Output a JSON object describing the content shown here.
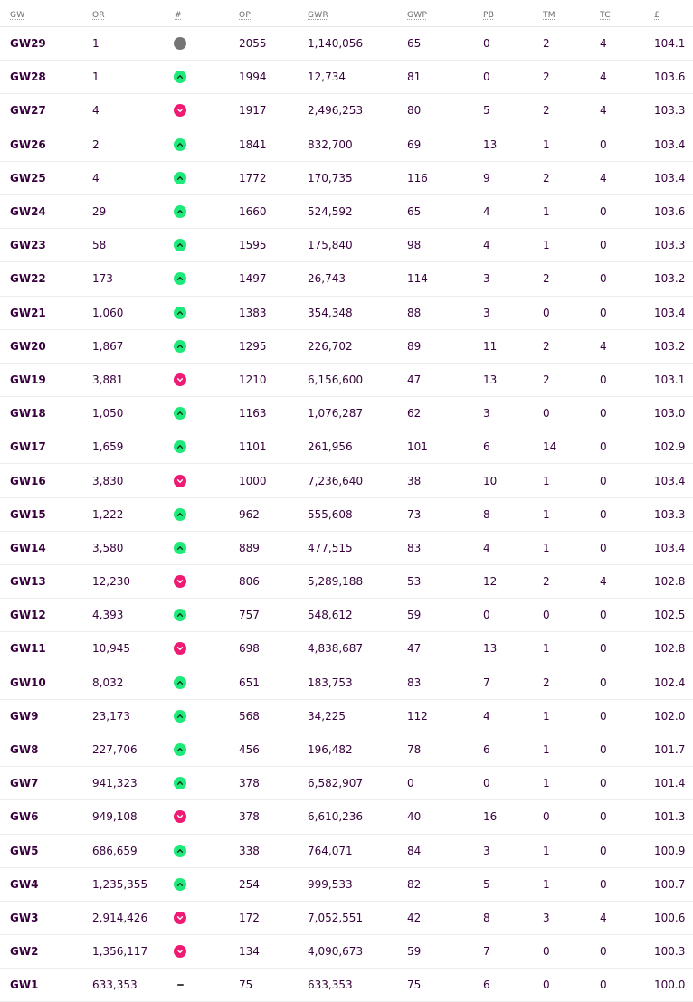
{
  "headers": [
    "GW",
    "OR",
    "#",
    "OP",
    "GWR",
    "GWP",
    "PB",
    "TM",
    "TC",
    "£"
  ],
  "colors": {
    "up": "#1fe97a",
    "down": "#ee1a73",
    "same": "#757575",
    "text": "#37003c"
  },
  "icons": {
    "up": "chevron-up-icon",
    "down": "chevron-down-icon",
    "same": "no-change-icon",
    "none": "dash-icon"
  },
  "rows": [
    {
      "gw": "GW29",
      "or": "1",
      "move": "same",
      "op": "2055",
      "gwr": "1,140,056",
      "gwp": "65",
      "pb": "0",
      "tm": "2",
      "tc": "4",
      "value": "104.1"
    },
    {
      "gw": "GW28",
      "or": "1",
      "move": "up",
      "op": "1994",
      "gwr": "12,734",
      "gwp": "81",
      "pb": "0",
      "tm": "2",
      "tc": "4",
      "value": "103.6"
    },
    {
      "gw": "GW27",
      "or": "4",
      "move": "down",
      "op": "1917",
      "gwr": "2,496,253",
      "gwp": "80",
      "pb": "5",
      "tm": "2",
      "tc": "4",
      "value": "103.3"
    },
    {
      "gw": "GW26",
      "or": "2",
      "move": "up",
      "op": "1841",
      "gwr": "832,700",
      "gwp": "69",
      "pb": "13",
      "tm": "1",
      "tc": "0",
      "value": "103.4"
    },
    {
      "gw": "GW25",
      "or": "4",
      "move": "up",
      "op": "1772",
      "gwr": "170,735",
      "gwp": "116",
      "pb": "9",
      "tm": "2",
      "tc": "4",
      "value": "103.4"
    },
    {
      "gw": "GW24",
      "or": "29",
      "move": "up",
      "op": "1660",
      "gwr": "524,592",
      "gwp": "65",
      "pb": "4",
      "tm": "1",
      "tc": "0",
      "value": "103.6"
    },
    {
      "gw": "GW23",
      "or": "58",
      "move": "up",
      "op": "1595",
      "gwr": "175,840",
      "gwp": "98",
      "pb": "4",
      "tm": "1",
      "tc": "0",
      "value": "103.3"
    },
    {
      "gw": "GW22",
      "or": "173",
      "move": "up",
      "op": "1497",
      "gwr": "26,743",
      "gwp": "114",
      "pb": "3",
      "tm": "2",
      "tc": "0",
      "value": "103.2"
    },
    {
      "gw": "GW21",
      "or": "1,060",
      "move": "up",
      "op": "1383",
      "gwr": "354,348",
      "gwp": "88",
      "pb": "3",
      "tm": "0",
      "tc": "0",
      "value": "103.4"
    },
    {
      "gw": "GW20",
      "or": "1,867",
      "move": "up",
      "op": "1295",
      "gwr": "226,702",
      "gwp": "89",
      "pb": "11",
      "tm": "2",
      "tc": "4",
      "value": "103.2"
    },
    {
      "gw": "GW19",
      "or": "3,881",
      "move": "down",
      "op": "1210",
      "gwr": "6,156,600",
      "gwp": "47",
      "pb": "13",
      "tm": "2",
      "tc": "0",
      "value": "103.1"
    },
    {
      "gw": "GW18",
      "or": "1,050",
      "move": "up",
      "op": "1163",
      "gwr": "1,076,287",
      "gwp": "62",
      "pb": "3",
      "tm": "0",
      "tc": "0",
      "value": "103.0"
    },
    {
      "gw": "GW17",
      "or": "1,659",
      "move": "up",
      "op": "1101",
      "gwr": "261,956",
      "gwp": "101",
      "pb": "6",
      "tm": "14",
      "tc": "0",
      "value": "102.9"
    },
    {
      "gw": "GW16",
      "or": "3,830",
      "move": "down",
      "op": "1000",
      "gwr": "7,236,640",
      "gwp": "38",
      "pb": "10",
      "tm": "1",
      "tc": "0",
      "value": "103.4"
    },
    {
      "gw": "GW15",
      "or": "1,222",
      "move": "up",
      "op": "962",
      "gwr": "555,608",
      "gwp": "73",
      "pb": "8",
      "tm": "1",
      "tc": "0",
      "value": "103.3"
    },
    {
      "gw": "GW14",
      "or": "3,580",
      "move": "up",
      "op": "889",
      "gwr": "477,515",
      "gwp": "83",
      "pb": "4",
      "tm": "1",
      "tc": "0",
      "value": "103.4"
    },
    {
      "gw": "GW13",
      "or": "12,230",
      "move": "down",
      "op": "806",
      "gwr": "5,289,188",
      "gwp": "53",
      "pb": "12",
      "tm": "2",
      "tc": "4",
      "value": "102.8"
    },
    {
      "gw": "GW12",
      "or": "4,393",
      "move": "up",
      "op": "757",
      "gwr": "548,612",
      "gwp": "59",
      "pb": "0",
      "tm": "0",
      "tc": "0",
      "value": "102.5"
    },
    {
      "gw": "GW11",
      "or": "10,945",
      "move": "down",
      "op": "698",
      "gwr": "4,838,687",
      "gwp": "47",
      "pb": "13",
      "tm": "1",
      "tc": "0",
      "value": "102.8"
    },
    {
      "gw": "GW10",
      "or": "8,032",
      "move": "up",
      "op": "651",
      "gwr": "183,753",
      "gwp": "83",
      "pb": "7",
      "tm": "2",
      "tc": "0",
      "value": "102.4"
    },
    {
      "gw": "GW9",
      "or": "23,173",
      "move": "up",
      "op": "568",
      "gwr": "34,225",
      "gwp": "112",
      "pb": "4",
      "tm": "1",
      "tc": "0",
      "value": "102.0"
    },
    {
      "gw": "GW8",
      "or": "227,706",
      "move": "up",
      "op": "456",
      "gwr": "196,482",
      "gwp": "78",
      "pb": "6",
      "tm": "1",
      "tc": "0",
      "value": "101.7"
    },
    {
      "gw": "GW7",
      "or": "941,323",
      "move": "up",
      "op": "378",
      "gwr": "6,582,907",
      "gwp": "0",
      "pb": "0",
      "tm": "1",
      "tc": "0",
      "value": "101.4"
    },
    {
      "gw": "GW6",
      "or": "949,108",
      "move": "down",
      "op": "378",
      "gwr": "6,610,236",
      "gwp": "40",
      "pb": "16",
      "tm": "0",
      "tc": "0",
      "value": "101.3"
    },
    {
      "gw": "GW5",
      "or": "686,659",
      "move": "up",
      "op": "338",
      "gwr": "764,071",
      "gwp": "84",
      "pb": "3",
      "tm": "1",
      "tc": "0",
      "value": "100.9"
    },
    {
      "gw": "GW4",
      "or": "1,235,355",
      "move": "up",
      "op": "254",
      "gwr": "999,533",
      "gwp": "82",
      "pb": "5",
      "tm": "1",
      "tc": "0",
      "value": "100.7"
    },
    {
      "gw": "GW3",
      "or": "2,914,426",
      "move": "down",
      "op": "172",
      "gwr": "7,052,551",
      "gwp": "42",
      "pb": "8",
      "tm": "3",
      "tc": "4",
      "value": "100.6"
    },
    {
      "gw": "GW2",
      "or": "1,356,117",
      "move": "down",
      "op": "134",
      "gwr": "4,090,673",
      "gwp": "59",
      "pb": "7",
      "tm": "0",
      "tc": "0",
      "value": "100.3"
    },
    {
      "gw": "GW1",
      "or": "633,353",
      "move": "none",
      "op": "75",
      "gwr": "633,353",
      "gwp": "75",
      "pb": "6",
      "tm": "0",
      "tc": "0",
      "value": "100.0"
    }
  ]
}
